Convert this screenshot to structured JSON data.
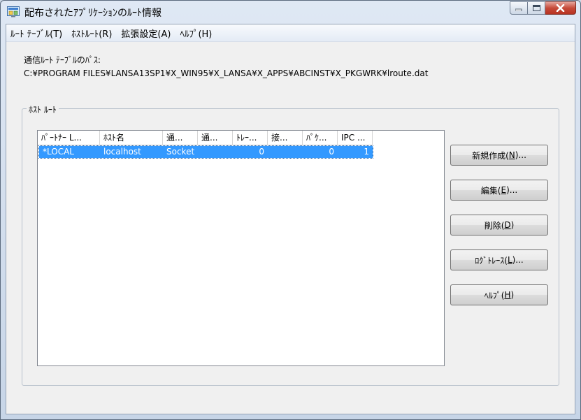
{
  "window": {
    "title": "配布されたｱﾌﾟﾘｹｰｼｮﾝのﾙｰﾄ情報"
  },
  "menu": {
    "items": [
      {
        "label": "ﾙｰﾄ ﾃｰﾌﾞﾙ(T)"
      },
      {
        "label": "ﾎｽﾄﾙｰﾄ(R)"
      },
      {
        "label": "拡張設定(A)"
      },
      {
        "label": "ﾍﾙﾌﾟ(H)"
      }
    ]
  },
  "route_table": {
    "path_label": "通信ﾙｰﾄ ﾃｰﾌﾞﾙのﾊﾟｽ:",
    "path_value": "C:¥PROGRAM FILES¥LANSA13SP1¥X_WIN95¥X_LANSA¥X_APPS¥ABCINST¥X_PKGWRK¥lroute.dat"
  },
  "host_routes": {
    "group_title": "ﾎｽﾄ ﾙｰﾄ",
    "columns": [
      "ﾊﾟｰﾄﾅｰ L...",
      "ﾎｽﾄ名",
      "通...",
      "通...",
      "ﾄﾚｰ...",
      "接...",
      "ﾊﾟｹ...",
      "IPC ..."
    ],
    "rows": [
      [
        "*LOCAL",
        "localhost",
        "Socket",
        "",
        "0",
        "",
        "0",
        "1"
      ]
    ]
  },
  "buttons": {
    "new": {
      "label": "新規作成(",
      "key": "N",
      "suffix": ")..."
    },
    "edit": {
      "label": "編集(",
      "key": "E",
      "suffix": ")..."
    },
    "delete": {
      "label": "削除(",
      "key": "D",
      "suffix": ")"
    },
    "log_trace": {
      "label": "ﾛｸﾞﾄﾚｰｽ(",
      "key": "L",
      "suffix": ")..."
    },
    "help": {
      "label": "ﾍﾙﾌﾟ(",
      "key": "H",
      "suffix": ")"
    }
  },
  "colors": {
    "selection": "#3399ff",
    "close_button": "#c64b3a"
  }
}
